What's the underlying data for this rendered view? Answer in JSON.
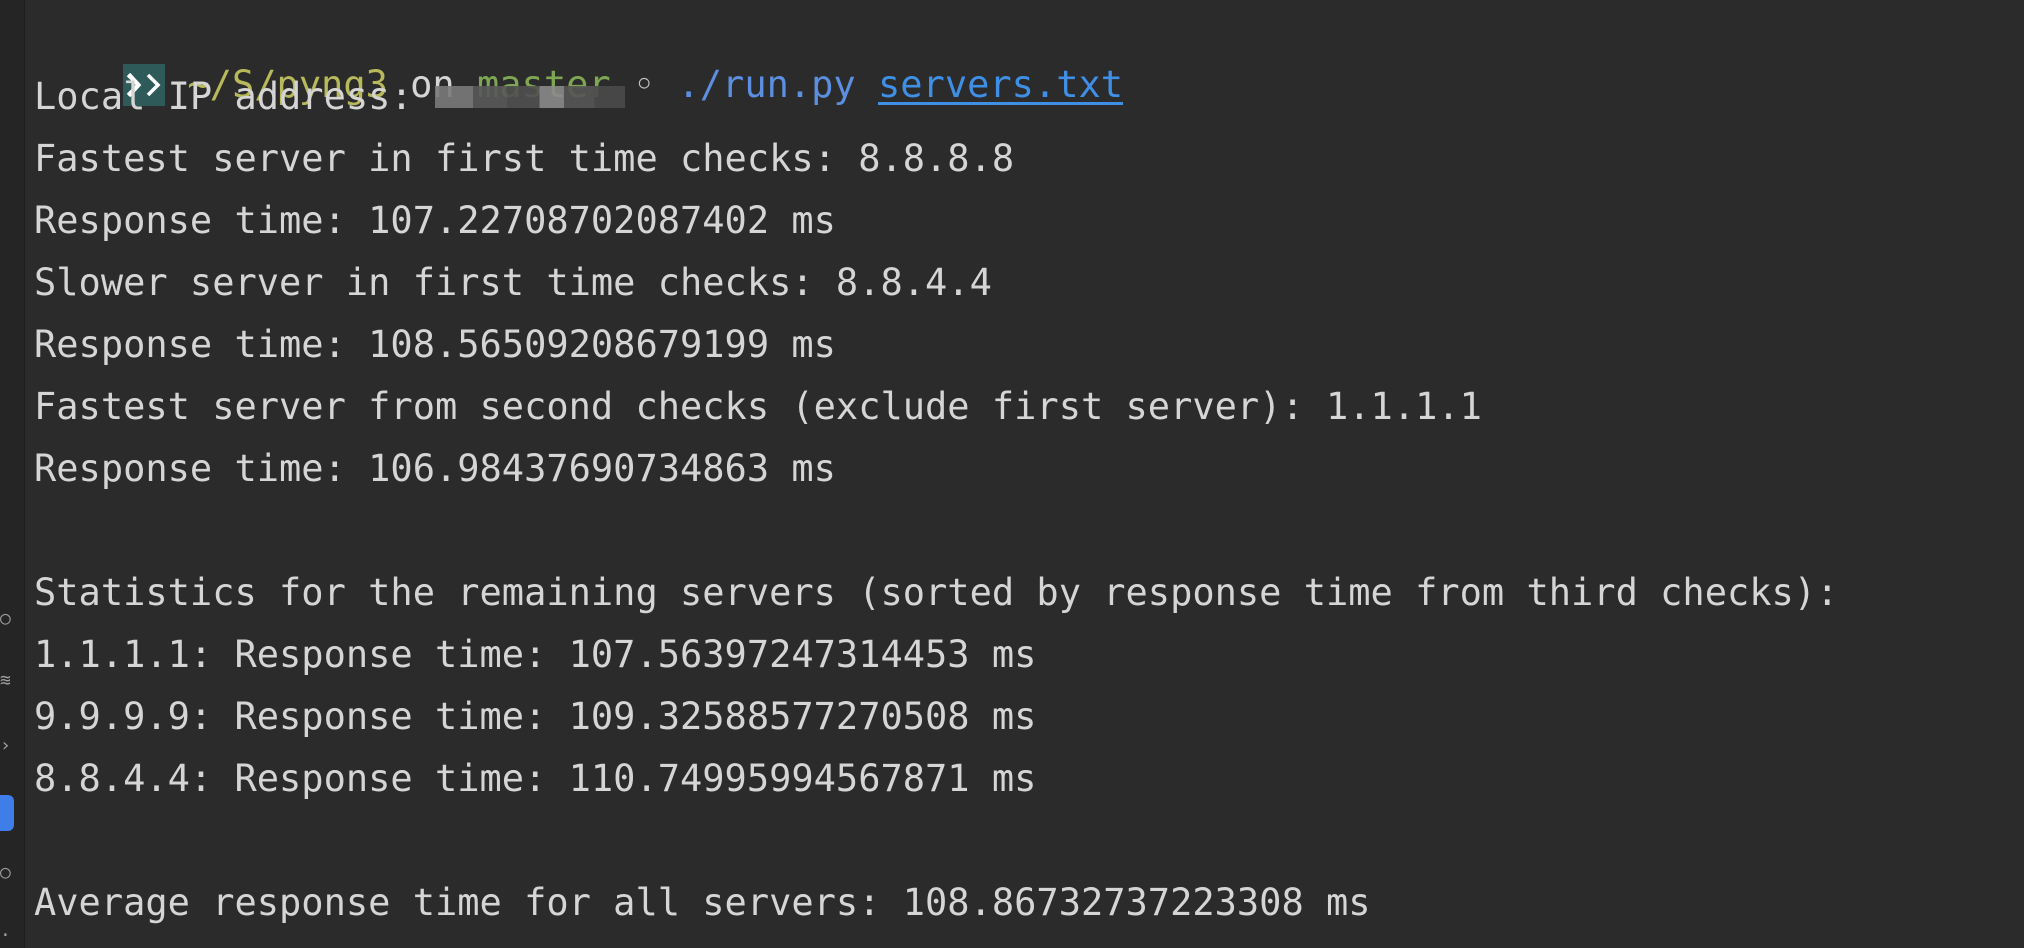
{
  "prompt": {
    "badge_icon": "terminal-prompt-icon",
    "path": "~/S/pyng3",
    "on_word": "on",
    "branch": "master",
    "separator": "◦",
    "command": "./run.py",
    "argument": "servers.txt"
  },
  "output": {
    "local_ip_label": "Local IP address:",
    "line_fastest_first": "Fastest server in first time checks: 8.8.8.8",
    "line_fastest_first_time": "Response time: 107.22708702087402 ms",
    "line_slower_first": "Slower server in first time checks: 8.8.4.4",
    "line_slower_first_time": "Response time: 108.56509208679199 ms",
    "line_fastest_second": "Fastest server from second checks (exclude first server): 1.1.1.1",
    "line_fastest_second_time": "Response time: 106.98437690734863 ms",
    "stats_header": "Statistics for the remaining servers (sorted by response time from third checks):",
    "stats_rows": [
      "1.1.1.1: Response time: 107.56397247314453 ms",
      "9.9.9.9: Response time: 109.32588577270508 ms",
      "8.8.4.4: Response time: 110.74995994567871 ms"
    ],
    "average_line": "Average response time for all servers: 108.86732737223308 ms"
  },
  "colors": {
    "background": "#2b2b2b",
    "text": "#d5d5d5",
    "path": "#b8b95a",
    "branch": "#7ea653",
    "command": "#5c8fe0",
    "argument_link": "#3f8fe6",
    "badge": "#2e5b5a",
    "gutter_active": "#3f7ee8"
  }
}
